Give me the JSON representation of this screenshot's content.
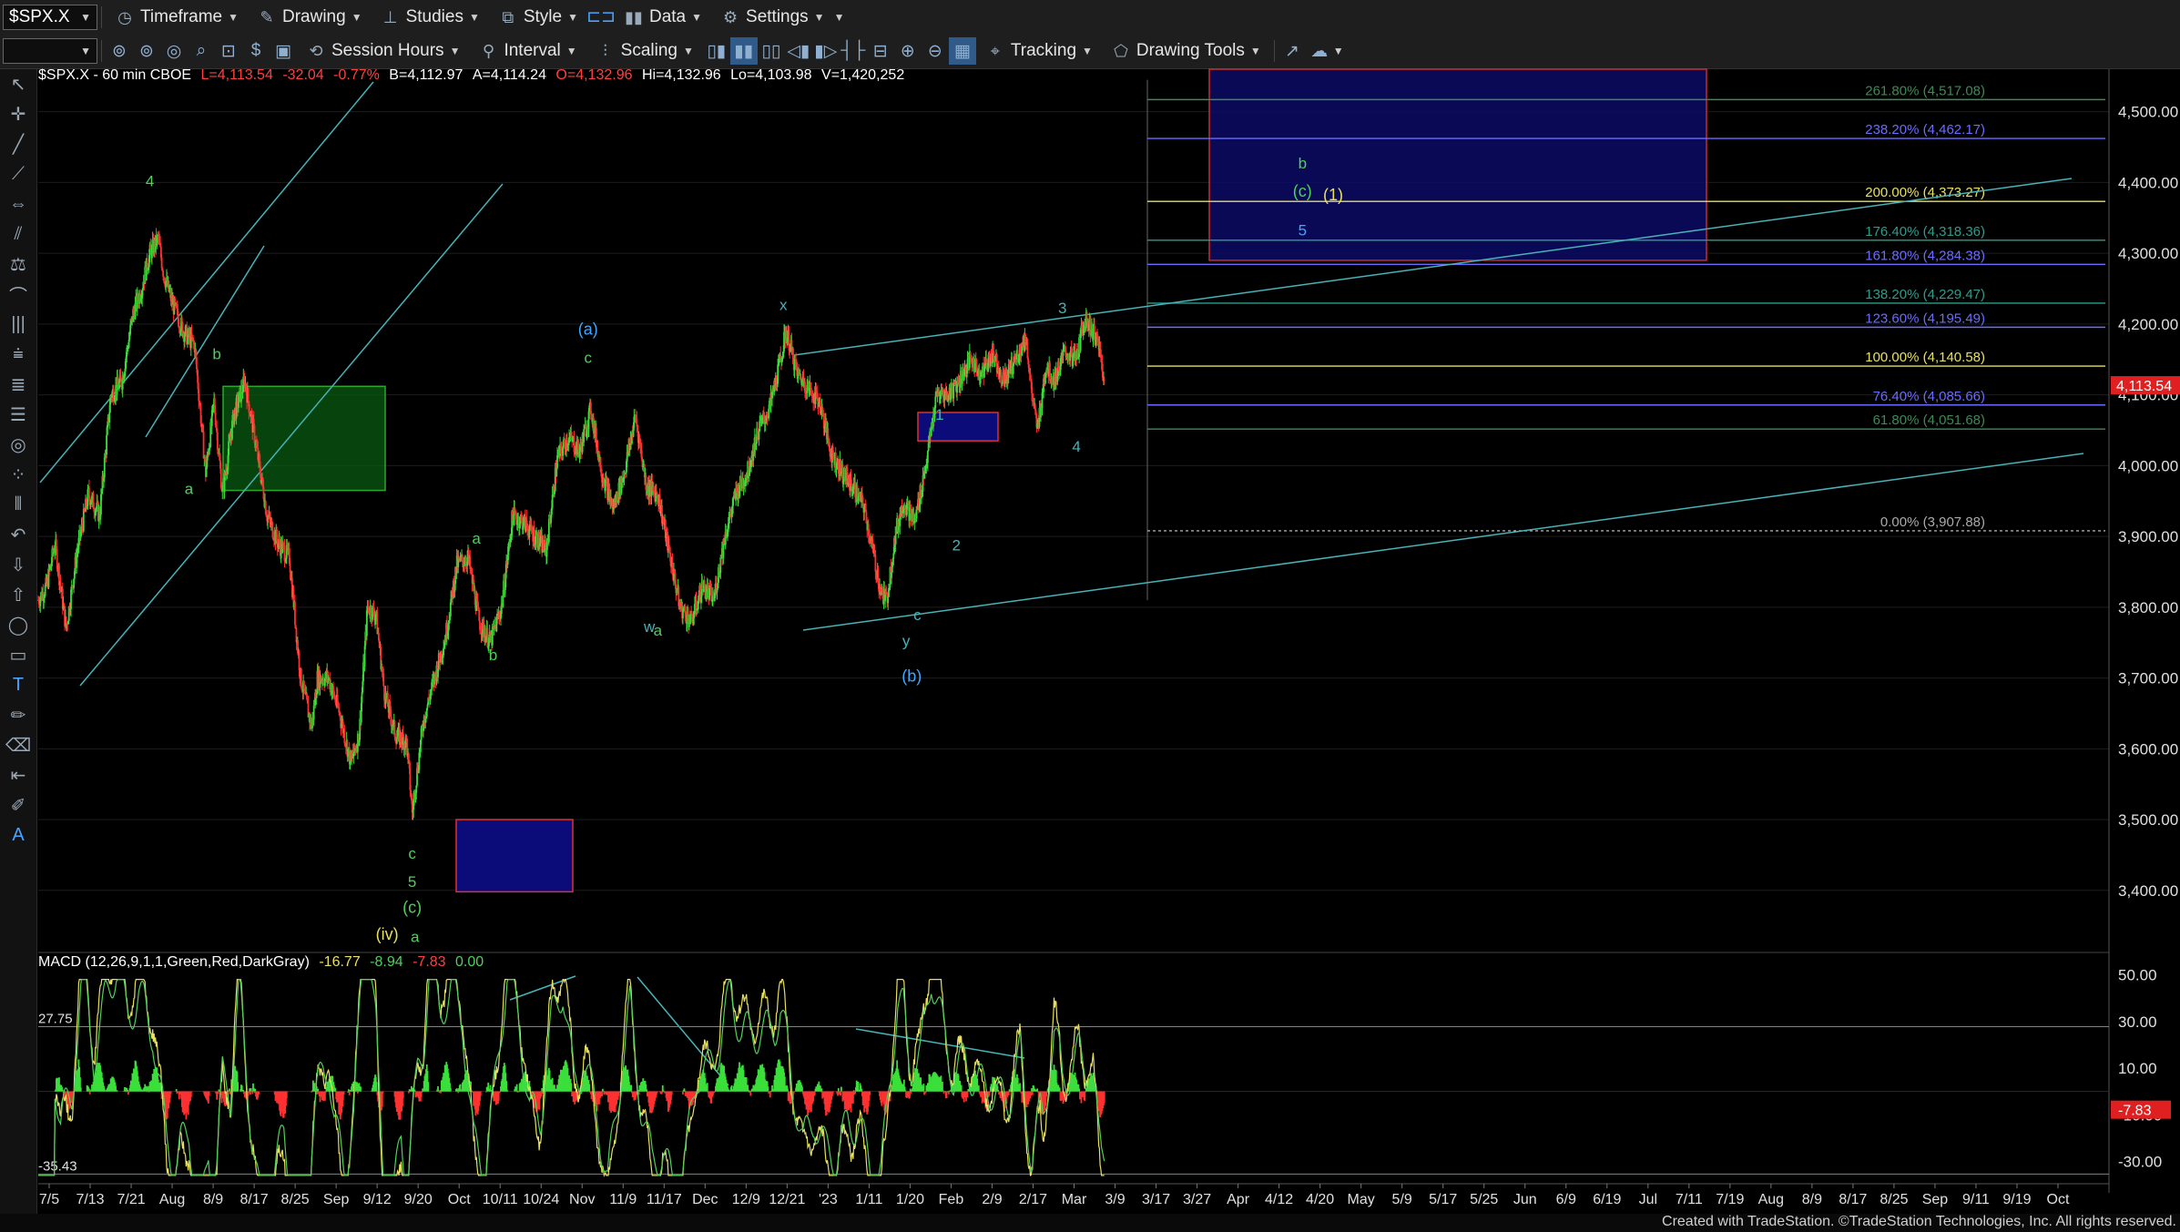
{
  "toolbar1": {
    "symbol": "$SPX.X",
    "timeframe": "Timeframe",
    "drawing": "Drawing",
    "studies": "Studies",
    "style": "Style",
    "data": "Data",
    "settings": "Settings"
  },
  "toolbar2": {
    "session_hours": "Session Hours",
    "interval": "Interval",
    "scaling": "Scaling",
    "tracking": "Tracking",
    "drawing_tools": "Drawing Tools"
  },
  "header": {
    "symbol_info": "$SPX.X - 60 min  CBOE",
    "low": "L=4,113.54",
    "net": "-32.04",
    "pct": "-0.77%",
    "bid": "B=4,112.97",
    "ask": "A=4,114.24",
    "open": "O=4,132.96",
    "high": "Hi=4,132.96",
    "lo": "Lo=4,103.98",
    "vol": "V=1,420,252"
  },
  "macd_header": {
    "label": "MACD (12,26,9,1,1,Green,Red,DarkGray)",
    "v1": "-16.77",
    "v2": "-8.94",
    "v3": "-7.83",
    "v4": "0.00"
  },
  "credit": "Created with TradeStation. ©TradeStation Technologies, Inc. All rights reserved.",
  "colors": {
    "up": "#3adf3a",
    "down": "#ff3030",
    "teal": "#47b3b8",
    "green_label": "#4fd05a",
    "yellow": "#e8e060",
    "blue_label": "#3fa7ff",
    "price_tag": "#e02020"
  },
  "chart_data": [
    {
      "type": "candlestick",
      "symbol": "$SPX.X",
      "interval": "60 min",
      "y_ticks": [
        "4,500.00",
        "4,400.00",
        "4,300.00",
        "4,200.00",
        "4,100.00",
        "4,000.00",
        "3,900.00",
        "3,800.00",
        "3,700.00",
        "3,600.00",
        "3,500.00",
        "3,400.00"
      ],
      "ylim": [
        3320,
        4560
      ],
      "last_price": "4,113.54",
      "x_ticks": [
        "7/5",
        "7/13",
        "7/21",
        "Aug",
        "8/9",
        "8/17",
        "8/25",
        "Sep",
        "9/12",
        "9/20",
        "Oct",
        "10/11",
        "10/24",
        "Nov",
        "11/9",
        "11/17",
        "Dec",
        "12/9",
        "12/21",
        "'23",
        "1/11",
        "1/20",
        "Feb",
        "2/9",
        "2/17",
        "Mar",
        "3/9",
        "3/17",
        "3/27",
        "Apr",
        "4/12",
        "4/20",
        "May",
        "5/9",
        "5/17",
        "5/25",
        "Jun",
        "6/9",
        "6/19",
        "Jul",
        "7/11",
        "7/19",
        "Aug",
        "8/9",
        "8/17",
        "8/25",
        "Sep",
        "9/11",
        "9/19",
        "Oct"
      ],
      "price_path": [
        [
          0,
          3810
        ],
        [
          3,
          3830
        ],
        [
          6,
          3890
        ],
        [
          10,
          3770
        ],
        [
          14,
          3880
        ],
        [
          18,
          3960
        ],
        [
          22,
          3930
        ],
        [
          26,
          4100
        ],
        [
          30,
          4120
        ],
        [
          34,
          4215
        ],
        [
          37,
          4250
        ],
        [
          40,
          4300
        ],
        [
          43,
          4320
        ],
        [
          45,
          4270
        ],
        [
          48,
          4230
        ],
        [
          52,
          4190
        ],
        [
          56,
          4170
        ],
        [
          60,
          3990
        ],
        [
          63,
          4090
        ],
        [
          66,
          3960
        ],
        [
          70,
          4070
        ],
        [
          74,
          4120
        ],
        [
          78,
          4030
        ],
        [
          82,
          3930
        ],
        [
          86,
          3890
        ],
        [
          90,
          3870
        ],
        [
          94,
          3700
        ],
        [
          98,
          3630
        ],
        [
          100,
          3700
        ],
        [
          104,
          3700
        ],
        [
          108,
          3650
        ],
        [
          112,
          3580
        ],
        [
          115,
          3620
        ],
        [
          118,
          3800
        ],
        [
          121,
          3790
        ],
        [
          124,
          3680
        ],
        [
          128,
          3620
        ],
        [
          132,
          3610
        ],
        [
          134,
          3510
        ],
        [
          138,
          3640
        ],
        [
          142,
          3700
        ],
        [
          146,
          3760
        ],
        [
          150,
          3860
        ],
        [
          154,
          3870
        ],
        [
          158,
          3780
        ],
        [
          162,
          3750
        ],
        [
          166,
          3800
        ],
        [
          170,
          3930
        ],
        [
          174,
          3920
        ],
        [
          178,
          3900
        ],
        [
          182,
          3880
        ],
        [
          186,
          4010
        ],
        [
          190,
          4040
        ],
        [
          194,
          4020
        ],
        [
          198,
          4080
        ],
        [
          202,
          3990
        ],
        [
          206,
          3940
        ],
        [
          210,
          3990
        ],
        [
          214,
          4070
        ],
        [
          218,
          3970
        ],
        [
          222,
          3960
        ],
        [
          226,
          3880
        ],
        [
          230,
          3800
        ],
        [
          234,
          3780
        ],
        [
          238,
          3830
        ],
        [
          242,
          3810
        ],
        [
          246,
          3900
        ],
        [
          250,
          3960
        ],
        [
          254,
          3990
        ],
        [
          258,
          4050
        ],
        [
          262,
          4080
        ],
        [
          266,
          4150
        ],
        [
          268,
          4190
        ],
        [
          272,
          4130
        ],
        [
          276,
          4110
        ],
        [
          280,
          4090
        ],
        [
          284,
          4020
        ],
        [
          288,
          3990
        ],
        [
          292,
          3970
        ],
        [
          296,
          3940
        ],
        [
          300,
          3860
        ],
        [
          302,
          3820
        ],
        [
          304,
          3810
        ],
        [
          307,
          3900
        ],
        [
          310,
          3950
        ],
        [
          314,
          3920
        ],
        [
          318,
          4000
        ],
        [
          322,
          4100
        ],
        [
          326,
          4100
        ],
        [
          330,
          4120
        ],
        [
          334,
          4150
        ],
        [
          338,
          4130
        ],
        [
          342,
          4160
        ],
        [
          346,
          4120
        ],
        [
          350,
          4150
        ],
        [
          354,
          4180
        ],
        [
          356,
          4100
        ],
        [
          358,
          4050
        ],
        [
          361,
          4140
        ],
        [
          364,
          4120
        ],
        [
          368,
          4160
        ],
        [
          372,
          4150
        ],
        [
          375,
          4210
        ],
        [
          378,
          4190
        ],
        [
          380,
          4170
        ],
        [
          382,
          4114
        ]
      ]
    },
    {
      "type": "fibonacci",
      "levels": [
        {
          "label": "261.80% (4,517.08)",
          "price": 4517.08,
          "color": "#3d8a55"
        },
        {
          "label": "238.20% (4,462.17)",
          "price": 4462.17,
          "color": "#6b6bff"
        },
        {
          "label": "200.00% (4,373.27)",
          "price": 4373.27,
          "color": "#e8e060"
        },
        {
          "label": "176.40% (4,318.36)",
          "price": 4318.36,
          "color": "#2d9c8c"
        },
        {
          "label": "161.80% (4,284.38)",
          "price": 4284.38,
          "color": "#6b6bff"
        },
        {
          "label": "138.20% (4,229.47)",
          "price": 4229.47,
          "color": "#2d9c8c"
        },
        {
          "label": "123.60% (4,195.49)",
          "price": 4195.49,
          "color": "#6b6bff"
        },
        {
          "label": "100.00% (4,140.58)",
          "price": 4140.58,
          "color": "#e8e060"
        },
        {
          "label": "76.40% (4,085.66)",
          "price": 4085.66,
          "color": "#6b6bff"
        },
        {
          "label": "61.80% (4,051.68)",
          "price": 4051.68,
          "color": "#3d8a55"
        },
        {
          "label": "0.00% (3,907.88)",
          "price": 3907.88,
          "color": "#aaaaaa"
        }
      ]
    },
    {
      "type": "annotations",
      "wave_labels": [
        {
          "text": "4",
          "color": "green",
          "bar": 40,
          "price": 4395
        },
        {
          "text": "b",
          "color": "green",
          "bar": 64,
          "price": 4150
        },
        {
          "text": "a",
          "color": "green",
          "bar": 54,
          "price": 3960
        },
        {
          "text": "c",
          "color": "green",
          "bar": 134,
          "price": 3445
        },
        {
          "text": "5",
          "color": "green",
          "bar": 134,
          "price": 3405
        },
        {
          "text": "(c)",
          "color": "green",
          "bar": 134,
          "price": 3368
        },
        {
          "text": "(iv)",
          "color": "yellow",
          "bar": 125,
          "price": 3330
        },
        {
          "text": "a",
          "color": "green",
          "bar": 135,
          "price": 3327
        },
        {
          "text": "a",
          "color": "green",
          "bar": 157,
          "price": 3890
        },
        {
          "text": "b",
          "color": "green",
          "bar": 163,
          "price": 3725
        },
        {
          "text": "(a)",
          "color": "blue",
          "bar": 197,
          "price": 4185
        },
        {
          "text": "c",
          "color": "green",
          "bar": 197,
          "price": 4145
        },
        {
          "text": "w",
          "color": "teal",
          "bar": 219,
          "price": 3765
        },
        {
          "text": "a",
          "color": "green",
          "bar": 222,
          "price": 3760
        },
        {
          "text": "x",
          "color": "teal",
          "bar": 267,
          "price": 4220
        },
        {
          "text": "c",
          "color": "teal",
          "bar": 315,
          "price": 3782
        },
        {
          "text": "y",
          "color": "teal",
          "bar": 311,
          "price": 3745
        },
        {
          "text": "(b)",
          "color": "blue",
          "bar": 313,
          "price": 3695
        },
        {
          "text": "1",
          "color": "teal",
          "bar": 323,
          "price": 4065
        },
        {
          "text": "2",
          "color": "teal",
          "bar": 329,
          "price": 3880
        },
        {
          "text": "3",
          "color": "teal",
          "bar": 367,
          "price": 4215
        },
        {
          "text": "4",
          "color": "teal",
          "bar": 372,
          "price": 4020
        },
        {
          "text": "b",
          "color": "green",
          "bar": 453,
          "price": 4420
        },
        {
          "text": "(c)",
          "color": "green",
          "bar": 453,
          "price": 4380
        },
        {
          "text": "(1)",
          "color": "yellow",
          "bar": 464,
          "price": 4375
        },
        {
          "text": "5",
          "color": "blue",
          "bar": 453,
          "price": 4325
        }
      ]
    },
    {
      "type": "macd",
      "yticks": [
        "50.00",
        "30.00",
        "10.00",
        "-10.00",
        "-30.00"
      ],
      "ylim": [
        -38,
        58
      ],
      "h_lines": [
        {
          "label": "27.75",
          "value": 27.75
        },
        {
          "label": "-35.43",
          "value": -35.43
        }
      ],
      "last_value": "-7.83"
    }
  ]
}
